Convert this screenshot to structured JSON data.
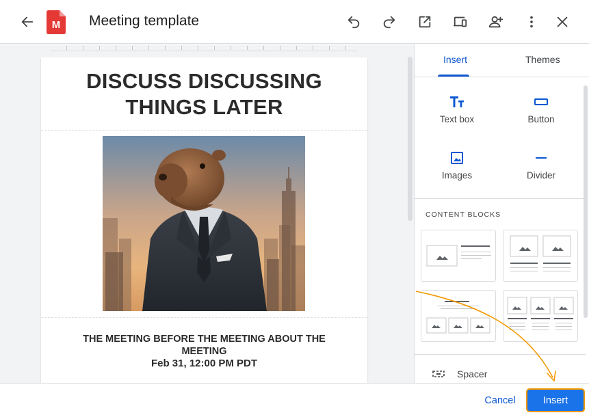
{
  "header": {
    "title": "Meeting template",
    "logo_letter": "M",
    "icons": [
      "arrow-back-icon",
      "undo-icon",
      "redo-icon",
      "open-in-new-icon",
      "devices-icon",
      "add-person-icon",
      "more-vert-icon",
      "close-icon"
    ]
  },
  "email": {
    "title_line1": "DISCUSS DISCUSSING",
    "title_line2": "THINGS LATER",
    "image_subject": "capybara-in-suit-photo",
    "subtitle_line1": "THE MEETING BEFORE THE MEETING ABOUT THE",
    "subtitle_line2": "MEETING",
    "date_time": "Feb 31, 12:00 PM PDT"
  },
  "panel": {
    "tabs": [
      {
        "label": "Insert",
        "active": true
      },
      {
        "label": "Themes",
        "active": false
      }
    ],
    "tools": [
      {
        "label": "Text box",
        "icon": "text-fields-icon"
      },
      {
        "label": "Button",
        "icon": "button-outline-icon"
      },
      {
        "label": "Images",
        "icon": "image-icon"
      },
      {
        "label": "Divider",
        "icon": "horizontal-rule-icon"
      }
    ],
    "content_blocks_heading": "CONTENT BLOCKS",
    "spacer_label": "Spacer"
  },
  "footer": {
    "cancel_label": "Cancel",
    "insert_label": "Insert"
  },
  "colors": {
    "accent": "#0b57d0",
    "insert_button_bg": "#1a73e8",
    "highlight_orange": "#f29900",
    "logo_red": "#e53935"
  }
}
